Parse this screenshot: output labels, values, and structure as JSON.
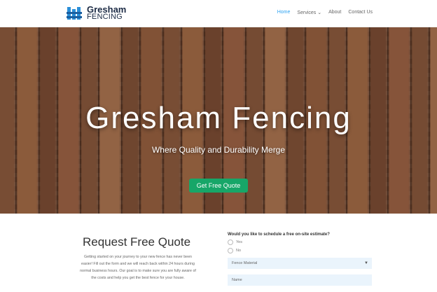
{
  "header": {
    "logo_name": "Gresham",
    "logo_sub": "FENCING",
    "nav": [
      {
        "label": "Home",
        "active": true
      },
      {
        "label": "Services",
        "active": false
      },
      {
        "label": "About",
        "active": false
      },
      {
        "label": "Contact Us",
        "active": false
      }
    ]
  },
  "hero": {
    "title": "Gresham Fencing",
    "subtitle": "Where Quality and Durability Merge",
    "cta_label": "Get Free Quote"
  },
  "quote": {
    "title": "Request Free Quote",
    "text": "Getting started on your journey to your new fence has never been easier! Fill out the form and we will reach back within 24 hours during normal business hours. Our goal is to make sure you are fully aware of the costs and help you get the best fence for your house."
  },
  "form": {
    "question": "Would you like to schedule a free on-site estimate?",
    "options": [
      "Yes",
      "No"
    ],
    "select_value": "Fence Material",
    "name_placeholder": "Name"
  },
  "colors": {
    "accent": "#2ea3f2",
    "cta": "#17a668",
    "field_bg": "#eaf4fc"
  }
}
